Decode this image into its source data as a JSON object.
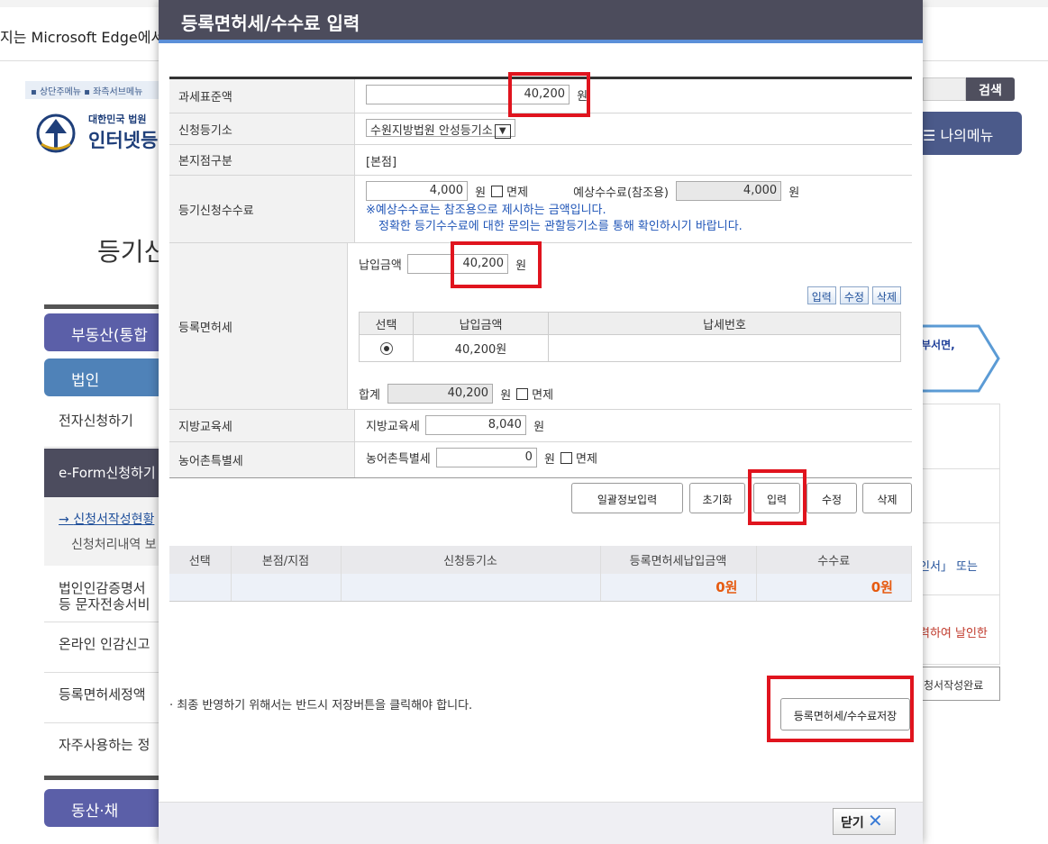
{
  "browser": {
    "edge_message": "지는 Microsoft Edge에서"
  },
  "background": {
    "util_links": [
      "상단주메뉴",
      "좌측서브메뉴"
    ],
    "logo_small": "대한민국 법원",
    "logo_big": "인터넷등",
    "page_title": "등기신",
    "search_label": "검색",
    "my_menu_label": "나의메뉴",
    "nav": {
      "realty": "부동산(통합",
      "corp": "법인",
      "e_apply": "전자신청하기",
      "eform": "e-Form신청하기",
      "sub_status": "신청서작성현황",
      "sub_process": "신청처리내역 보",
      "seal_sms_1": "법인인감증명서",
      "seal_sms_2": "등 문자전송서비",
      "online_seal": "온라인 인감신고",
      "tax_refund": "등록면허세정액",
      "frequent": "자주사용하는 정",
      "movables": "동산·채"
    },
    "arrow_text": "부서면,",
    "right_text_1": "인서」 또는",
    "right_text_2": "력하여 날인한",
    "done_label": "청서작성완료"
  },
  "dialog": {
    "title": "등록면허세/수수료 입력",
    "rows": {
      "tax_base_label": "과세표준액",
      "tax_base_value": "40,200",
      "won": "원",
      "registry_office_label": "신청등기소",
      "registry_office_value": "수원지방법원 안성등기소",
      "branch_label": "본지점구분",
      "branch_value": "[본점]",
      "fee_label": "등기신청수수료",
      "fee_value": "4,000",
      "exempt": "면제",
      "expected_fee_label": "예상수수료(참조용)",
      "expected_fee_value": "4,000",
      "fee_notice_1": "※예상수수료는 참조용으로 제시하는 금액입니다.",
      "fee_notice_2": "정확한 등기수수료에 대한 문의는 관할등기소를 통해 확인하시기 바랍니다.",
      "license_tax_label": "등록면허세",
      "pay_amount_label": "납입금액",
      "pay_amount_value": "40,200",
      "btn_input_small": "입력",
      "btn_edit_small": "수정",
      "btn_delete_small": "삭제",
      "inner_headers": [
        "선택",
        "납입금액",
        "납세번호"
      ],
      "inner_row": {
        "amount": "40,200원",
        "tax_no": ""
      },
      "total_label": "합계",
      "total_value": "40,200",
      "local_edu_label": "지방교육세",
      "local_edu_inline_label": "지방교육세",
      "local_edu_value": "8,040",
      "rural_label": "농어촌특별세",
      "rural_inline_label": "농어촌특별세",
      "rural_value": "0"
    },
    "buttons": {
      "bulk": "일괄정보입력",
      "reset": "초기화",
      "input": "입력",
      "edit": "수정",
      "delete": "삭제",
      "save": "등록면허세/수수료저장",
      "close": "닫기"
    },
    "summary": {
      "headers": [
        "선택",
        "본점/지점",
        "신청등기소",
        "등록면허세납입금액",
        "수수료"
      ],
      "license_total": "0원",
      "fee_total": "0원"
    },
    "final_note": "· 최종 반영하기 위해서는 반드시 저장버튼을 클릭해야 합니다."
  },
  "colors": {
    "dialog_header": "#4c4c5c",
    "accent_blue": "#5b8fd8",
    "highlight_red": "#e0141e",
    "amount_orange": "#e65a10"
  }
}
